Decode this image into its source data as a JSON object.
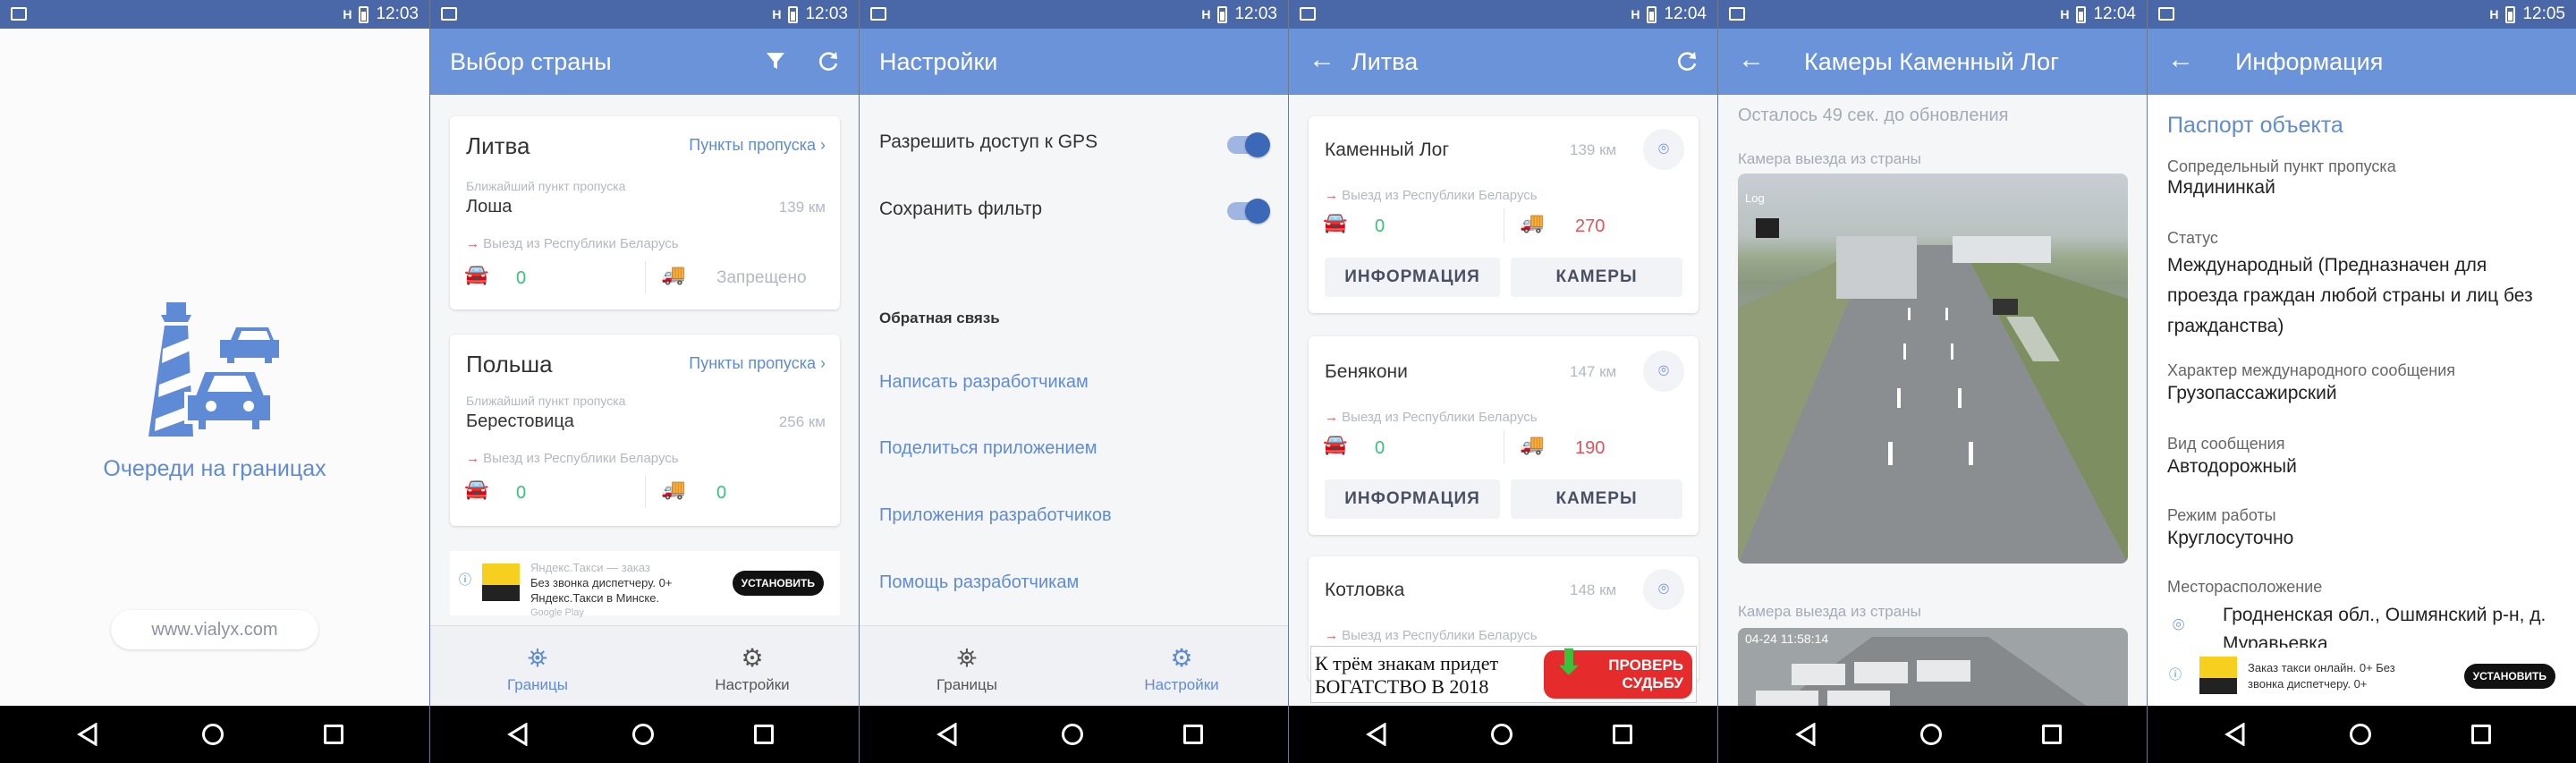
{
  "status_bar": [
    {
      "time": "12:03",
      "signal": "H"
    },
    {
      "time": "12:03",
      "signal": "H"
    },
    {
      "time": "12:03",
      "signal": "H"
    },
    {
      "time": "12:04",
      "signal": "H"
    },
    {
      "time": "12:04",
      "signal": "H"
    },
    {
      "time": "12:05",
      "signal": "H"
    }
  ],
  "splash": {
    "app_name": "Очереди на границах",
    "website": "www.vialyx.com"
  },
  "country_select": {
    "title": "Выбор страны",
    "cards": [
      {
        "country": "Литва",
        "link": "Пункты пропуска",
        "nearest_label": "Ближайший пункт пропуска",
        "checkpoint": "Лоша",
        "distance": "139 км",
        "direction": "Выезд из Республики Беларусь",
        "cars": "0",
        "trucks": "Запрещено"
      },
      {
        "country": "Польша",
        "link": "Пункты пропуска",
        "nearest_label": "Ближайший пункт пропуска",
        "checkpoint": "Берестовица",
        "distance": "256 км",
        "direction": "Выезд из Республики Беларусь",
        "cars": "0",
        "trucks": "0"
      }
    ],
    "ad": {
      "line1": "Яндекс.Такси — заказ",
      "line2": "Без звонка диспетчеру. 0+",
      "line3": "Яндекс.Такси в Минске.",
      "line4": "Google Play",
      "button": "УСТАНОВИТЬ"
    }
  },
  "bottom_tabs": {
    "borders": "Границы",
    "settings": "Настройки"
  },
  "settings": {
    "title": "Настройки",
    "gps": "Разрешить доступ к GPS",
    "save_filter": "Сохранить фильтр",
    "feedback_header": "Обратная связь",
    "links": [
      "Написать разработчикам",
      "Поделиться приложением",
      "Приложения разработчиков",
      "Помощь разработчикам"
    ]
  },
  "lithuania": {
    "title": "Литва",
    "points": [
      {
        "name": "Каменный Лог",
        "distance": "139 км",
        "direction": "Выезд из Республики Беларусь",
        "cars": "0",
        "trucks": "270"
      },
      {
        "name": "Бенякони",
        "distance": "147 км",
        "direction": "Выезд из Республики Беларусь",
        "cars": "0",
        "trucks": "190"
      },
      {
        "name": "Котловка",
        "distance": "148 км",
        "direction": "Выезд из Республики Беларусь"
      }
    ],
    "info_button": "ИНФОРМАЦИЯ",
    "cameras_button": "КАМЕРЫ",
    "ad": {
      "text1": "К трём знакам придет",
      "text2": "БОГАТСТВО В 2018",
      "button1": "ПРОВЕРЬ",
      "button2": "СУДЬБУ"
    }
  },
  "cameras": {
    "title": "Камеры Каменный Лог",
    "countdown": "Осталось 49 сек. до обновления",
    "cam1_label": "Камера выезда из страны",
    "cam1_overlay": "Log",
    "cam2_label": "Камера выезда из страны",
    "cam2_overlay": "04-24 11:58:14"
  },
  "info": {
    "title": "Информация",
    "section": "Паспорт объекта",
    "fields": [
      {
        "label": "Сопредельный пункт пропуска",
        "value": "Мядининкай"
      },
      {
        "label": "Статус",
        "value": "Международный (Предназначен для проезда граждан любой страны и лиц без гражданства)"
      },
      {
        "label": "Характер международного сообщения",
        "value": "Грузопассажирский"
      },
      {
        "label": "Вид сообщения",
        "value": "Автодорожный"
      },
      {
        "label": "Режим работы",
        "value": "Круглосуточно"
      },
      {
        "label": "Месторасположение",
        "value": "Гродненская обл., Ошмянский р-н, д. Мурaвьевка"
      }
    ],
    "ad": {
      "line1": "Заказ такси онлайн. 0+ Без",
      "line2": "звонка диспетчеру. 0+",
      "button": "УСТАНОВИТЬ"
    }
  },
  "colors": {
    "status_bar": "#4a67a8",
    "app_bar": "#6a93d9",
    "accent": "#5f8bd6",
    "green": "#38c27a",
    "red": "#e4525b"
  }
}
